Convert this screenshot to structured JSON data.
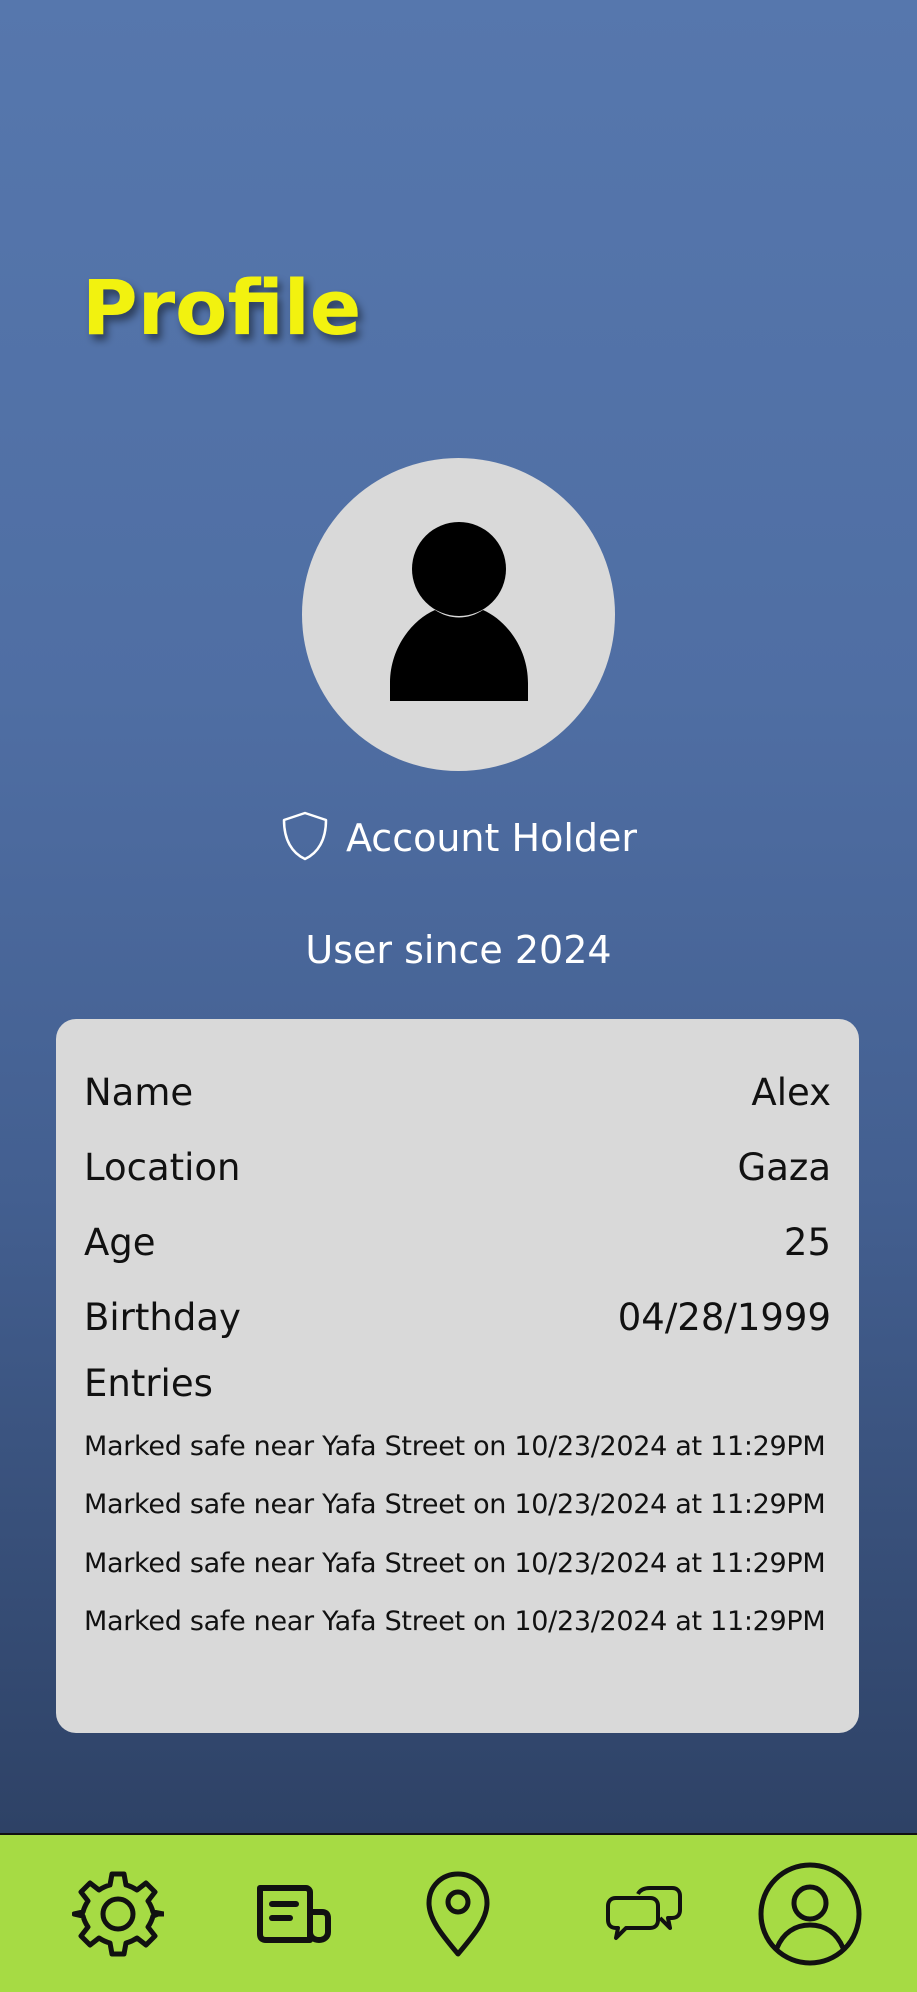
{
  "header": {
    "title": "Profile"
  },
  "profile": {
    "role": "Account Holder",
    "since": "User since 2024"
  },
  "details": {
    "name_label": "Name",
    "name_value": "Alex",
    "location_label": "Location",
    "location_value": "Gaza",
    "age_label": "Age",
    "age_value": "25",
    "birthday_label": "Birthday",
    "birthday_value": "04/28/1999"
  },
  "entries": {
    "title": "Entries",
    "items": [
      "Marked safe near Yafa Street on 10/23/2024 at 11:29PM",
      "Marked safe near Yafa Street on 10/23/2024 at 11:29PM",
      "Marked safe near Yafa Street on 10/23/2024 at 11:29PM",
      "Marked safe near Yafa Street on 10/23/2024 at 11:29PM"
    ]
  },
  "nav": {
    "icons": [
      "gear-icon",
      "news-icon",
      "map-pin-icon",
      "chat-icon",
      "profile-icon"
    ],
    "active": "profile"
  },
  "colors": {
    "title": "#f2f20f",
    "card": "#d9d9d9",
    "navbar": "#a6db44",
    "background_top": "#5677ad",
    "background_bottom": "#2a3c5c"
  }
}
